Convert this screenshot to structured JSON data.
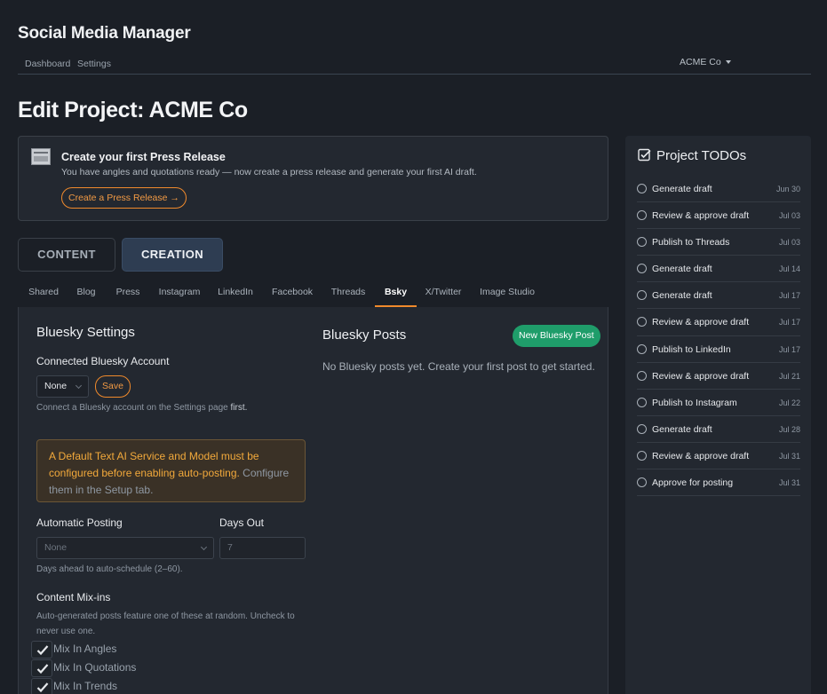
{
  "app": {
    "title": "Social Media Manager"
  },
  "nav": {
    "links": [
      "Dashboard",
      "Settings"
    ],
    "account": "ACME Co"
  },
  "page": {
    "title": "Edit Project: ACME Co"
  },
  "banner": {
    "title": "Create your first Press Release",
    "description": "You have angles and quotations ready — now create a press release and generate your first AI draft.",
    "button": "Create a Press Release →"
  },
  "modes": {
    "content": "CONTENT",
    "creation": "CREATION",
    "active": "creation"
  },
  "tabs": {
    "items": [
      "Shared",
      "Blog",
      "Press",
      "Instagram",
      "LinkedIn",
      "Facebook",
      "Threads",
      "Bsky",
      "X/Twitter",
      "Image Studio"
    ],
    "active": "Bsky"
  },
  "settings": {
    "title": "Bluesky Settings",
    "account_label": "Connected Bluesky Account",
    "account_value": "None",
    "save_label": "Save",
    "account_hint_prefix": "Connect a Bluesky account on the Settings page",
    "account_hint_suffix": "first.",
    "warning_text": "A Default Text AI Service and Model must be configured before enabling auto-posting.",
    "warning_link": "Configure them in the Setup tab.",
    "auto_label": "Automatic Posting",
    "auto_value": "None",
    "days_label": "Days Out",
    "days_value": "7",
    "days_hint": "Days ahead to auto-schedule (2–60).",
    "mixins_label": "Content Mix-ins",
    "mixins_hint": "Auto-generated posts feature one of these at random. Uncheck to never use one.",
    "mixins": [
      {
        "label": "Mix In Angles",
        "checked": true
      },
      {
        "label": "Mix In Quotations",
        "checked": true
      },
      {
        "label": "Mix In Trends",
        "checked": true
      }
    ]
  },
  "posts": {
    "title": "Bluesky Posts",
    "new_button": "New Bluesky Post",
    "empty": "No Bluesky posts yet. Create your first post to get started."
  },
  "todos": {
    "title": "Project TODOs",
    "items": [
      {
        "label": "Generate draft",
        "date": "Jun 30"
      },
      {
        "label": "Review & approve draft",
        "date": "Jul 03"
      },
      {
        "label": "Publish to Threads",
        "date": "Jul 03"
      },
      {
        "label": "Generate draft",
        "date": "Jul 14"
      },
      {
        "label": "Generate draft",
        "date": "Jul 17"
      },
      {
        "label": "Review & approve draft",
        "date": "Jul 17"
      },
      {
        "label": "Publish to LinkedIn",
        "date": "Jul 17"
      },
      {
        "label": "Review & approve draft",
        "date": "Jul 21"
      },
      {
        "label": "Publish to Instagram",
        "date": "Jul 22"
      },
      {
        "label": "Generate draft",
        "date": "Jul 28"
      },
      {
        "label": "Review & approve draft",
        "date": "Jul 31"
      },
      {
        "label": "Approve for posting",
        "date": "Jul 31"
      }
    ]
  },
  "colors": {
    "accent": "#f08a2c",
    "primary": "#1f9d6a",
    "warning": "#f2a93b"
  }
}
